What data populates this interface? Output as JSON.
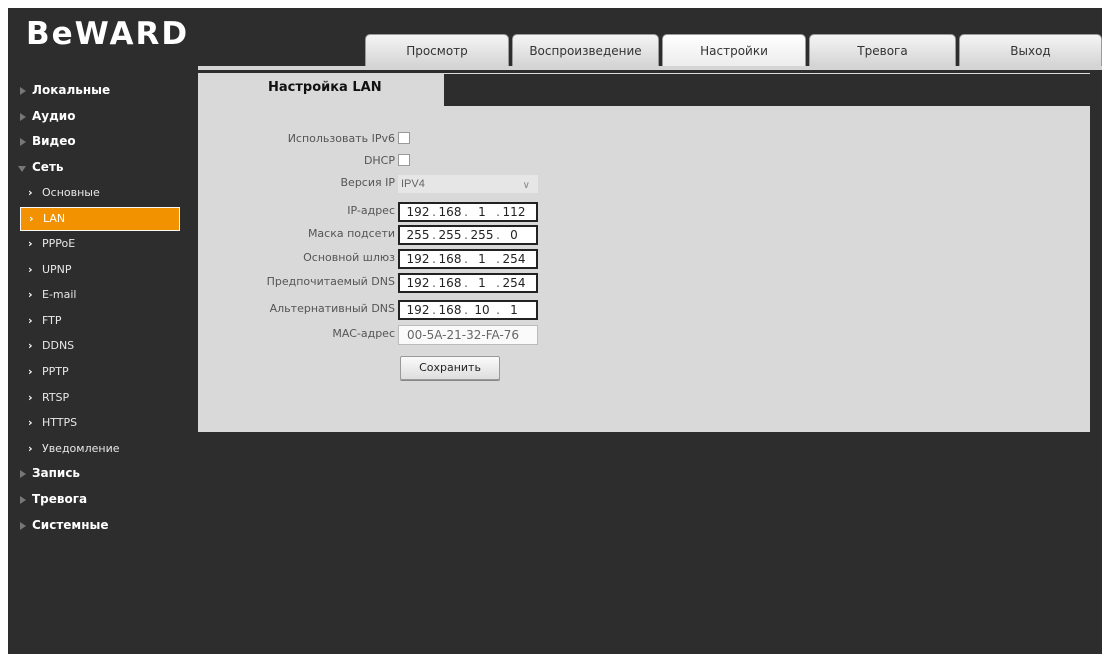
{
  "brand": {
    "logo_text": "BeWARD"
  },
  "tabs": [
    {
      "label": "Просмотр",
      "active": false
    },
    {
      "label": "Воспроизведение",
      "active": false
    },
    {
      "label": "Настройки",
      "active": true
    },
    {
      "label": "Тревога",
      "active": false
    },
    {
      "label": "Выход",
      "active": false
    }
  ],
  "sidebar": {
    "items": [
      {
        "label": "Локальные"
      },
      {
        "label": "Аудио"
      },
      {
        "label": "Видео"
      },
      {
        "label": "Сеть",
        "expanded": true
      },
      {
        "label": "Основные"
      },
      {
        "label": "LAN",
        "selected": true
      },
      {
        "label": "PPPoE"
      },
      {
        "label": "UPNP"
      },
      {
        "label": "E-mail"
      },
      {
        "label": "FTP"
      },
      {
        "label": "DDNS"
      },
      {
        "label": "PPTP"
      },
      {
        "label": "RTSP"
      },
      {
        "label": "HTTPS"
      },
      {
        "label": "Уведомление"
      },
      {
        "label": "Запись"
      },
      {
        "label": "Тревога"
      },
      {
        "label": "Системные"
      }
    ]
  },
  "panel": {
    "title": "Настройка LAN"
  },
  "form": {
    "ipv6": {
      "label": "Использовать IPv6",
      "checked": false
    },
    "dhcp": {
      "label": "DHCP",
      "checked": false
    },
    "ip_version": {
      "label": "Версия IP",
      "value": "IPV4"
    },
    "ip_address": {
      "label": "IP-адрес",
      "octets": [
        "192",
        "168",
        "1",
        "112"
      ]
    },
    "subnet_mask": {
      "label": "Маска подсети",
      "octets": [
        "255",
        "255",
        "255",
        "0"
      ]
    },
    "gateway": {
      "label": "Основной шлюз",
      "octets": [
        "192",
        "168",
        "1",
        "254"
      ]
    },
    "preferred_dns": {
      "label": "Предпочитаемый DNS",
      "octets": [
        "192",
        "168",
        "1",
        "254"
      ]
    },
    "alternate_dns": {
      "label": "Альтернативный DNS",
      "octets": [
        "192",
        "168",
        "10",
        "1"
      ]
    },
    "mac": {
      "label": "MAC-адрес",
      "value": "00-5A-21-32-FA-76"
    },
    "save_label": "Сохранить"
  },
  "colors": {
    "background": "#2d2d2d",
    "panel": "#d9d9d9",
    "accent": "#f39200"
  }
}
